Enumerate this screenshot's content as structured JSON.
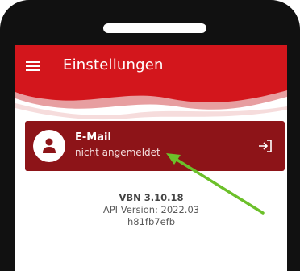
{
  "app_bar": {
    "title": "Einstellungen",
    "menu_icon": "hamburger-menu-icon",
    "background_color": "#d3161c"
  },
  "account_card": {
    "title": "E-Mail",
    "status": "nicht angemeldet",
    "avatar_icon": "user-icon",
    "action_icon": "login-icon",
    "background_color": "#8d1418"
  },
  "version_info": {
    "app_version": "VBN 3.10.18",
    "api_version": "API Version: 2022.03",
    "build_hash": "h81fb7efb"
  },
  "annotation": {
    "arrow_color": "#6cc02a"
  }
}
